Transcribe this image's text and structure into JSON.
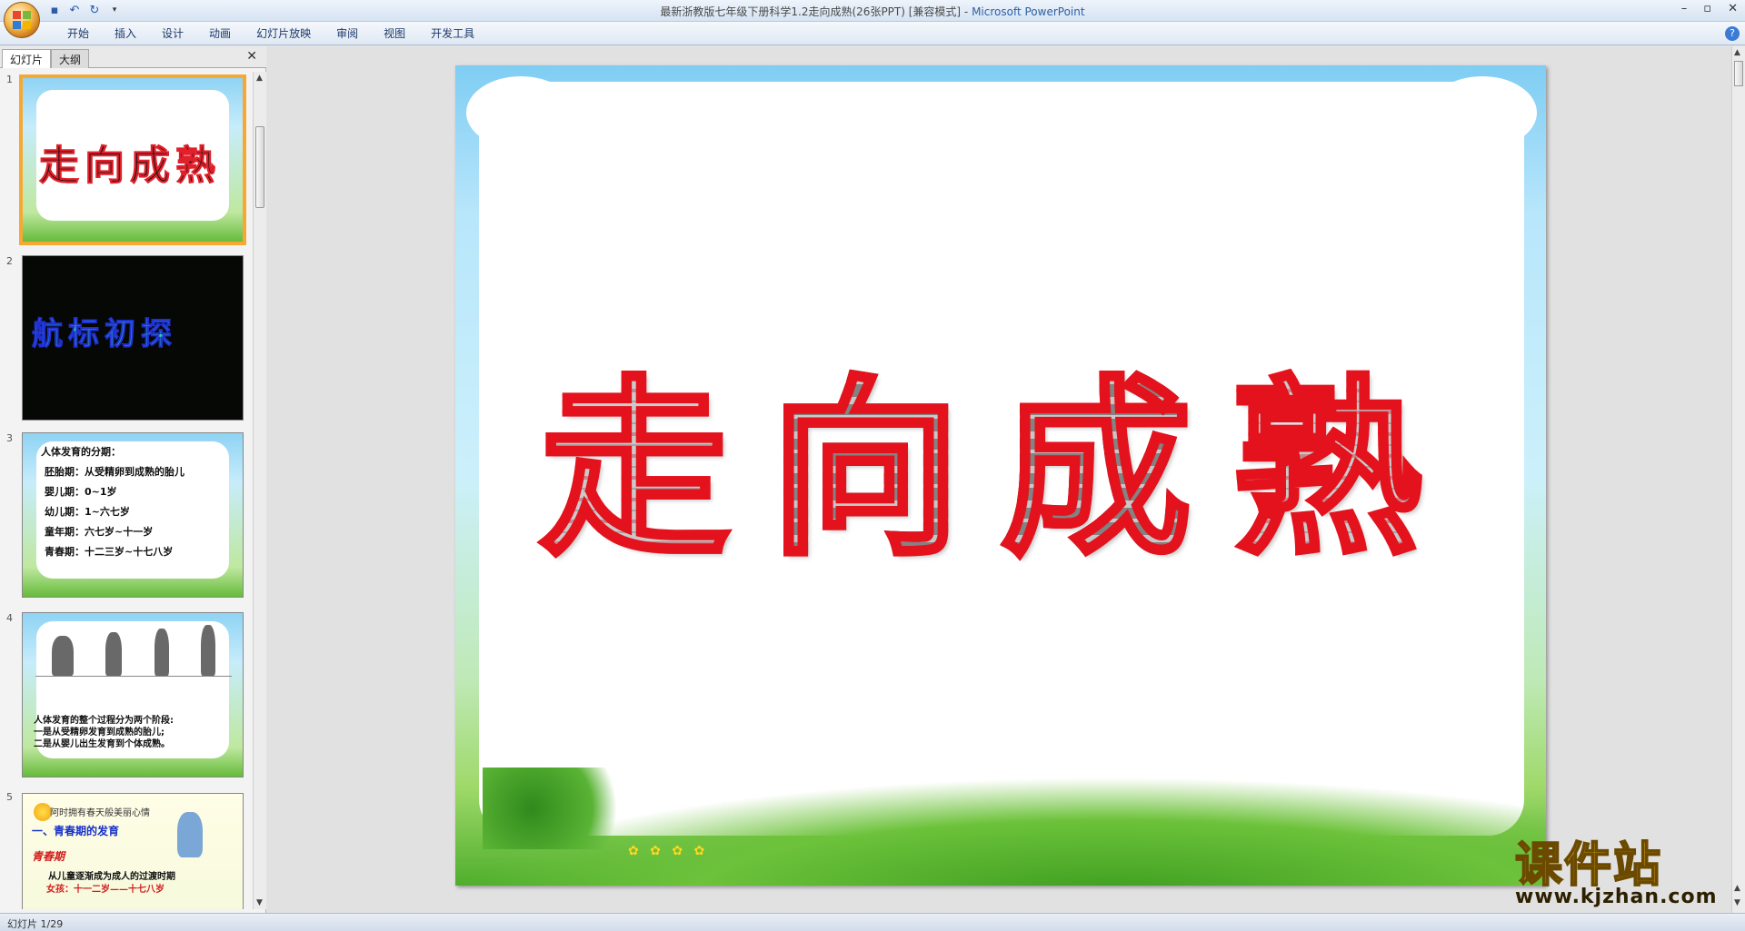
{
  "window": {
    "title_doc": "最新浙教版七年级下册科学1.2走向成熟(26张PPT) [兼容模式]",
    "title_sep": " - ",
    "title_app": "Microsoft PowerPoint",
    "controls": [
      "–",
      "▫",
      "✕"
    ]
  },
  "ribbon": {
    "tabs": [
      "开始",
      "插入",
      "设计",
      "动画",
      "幻灯片放映",
      "审阅",
      "视图",
      "开发工具"
    ],
    "help": "?"
  },
  "panel": {
    "tab_slides": "幻灯片",
    "tab_outline": "大纲",
    "close": "✕"
  },
  "thumbnails": [
    {
      "num": "1",
      "title": "走向成熟"
    },
    {
      "num": "2",
      "title": "航标初探"
    },
    {
      "num": "3",
      "heading": "人体发育的分期：",
      "items": [
        "胚胎期：从受精卵到成熟的胎儿",
        "婴儿期：0~1岁",
        "幼儿期：1~六七岁",
        "童年期：六七岁~十一岁",
        "青春期：十二三岁~十七八岁"
      ]
    },
    {
      "num": "4",
      "lines": [
        "人体发育的整个过程分为两个阶段:",
        "一是从受精卵发育到成熟的胎儿;",
        "二是从婴儿出生发育到个体成熟。"
      ]
    },
    {
      "num": "5",
      "line1": "阿时拥有春天般美丽心情",
      "line2": "一、青春期的发育",
      "line3": "青春期",
      "line4": "从儿童逐渐成为成人的过渡时期",
      "line5": "女孩：十一二岁——十七八岁"
    }
  ],
  "slide": {
    "title_chars": [
      "走",
      "向",
      "成",
      "熟"
    ]
  },
  "status": {
    "text": "幻灯片 1/29"
  },
  "watermark": {
    "name": "课件站",
    "url": "www.kjzhan.com"
  },
  "colors": {
    "title_outline": "#e3121c",
    "selection": "#f7a833",
    "watermark": "#f2c318"
  }
}
